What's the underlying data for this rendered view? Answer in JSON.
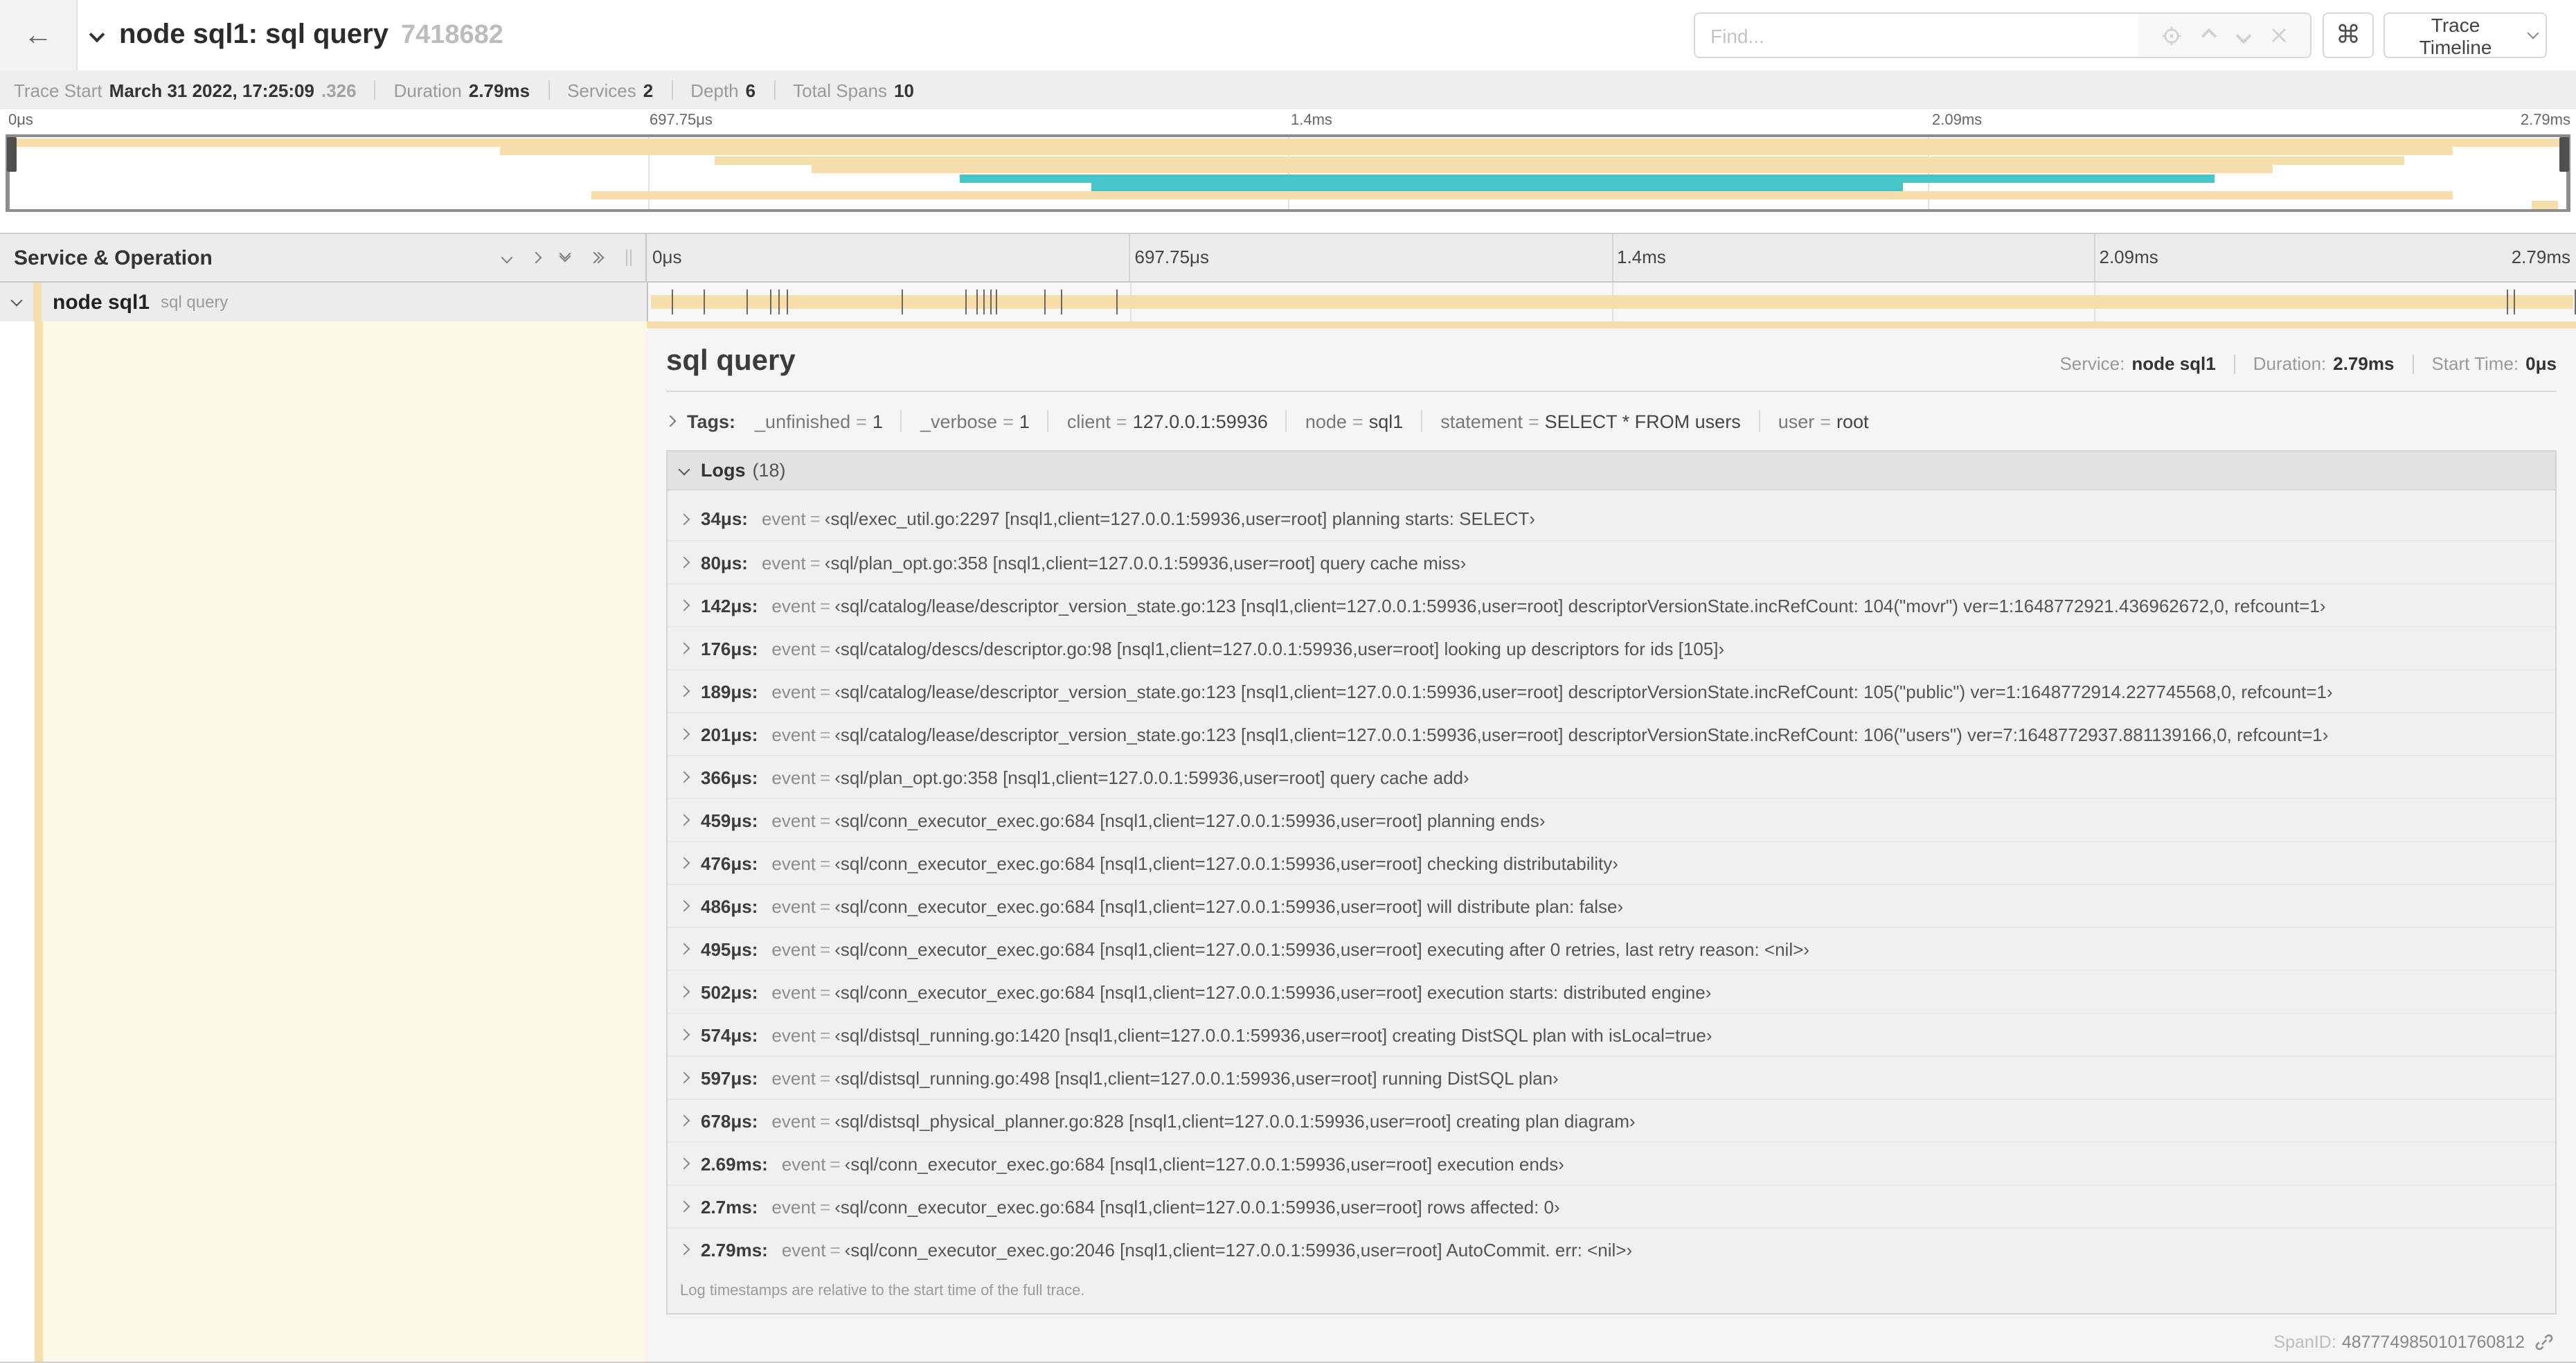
{
  "colors": {
    "tan": "#f6dfab",
    "teal": "#47c5c6",
    "cream": "#fdf7e8",
    "selected_row_bg": "#ececec"
  },
  "header": {
    "back_icon": "←",
    "title": "node sql1: sql query",
    "trace_id": "7418682",
    "find_placeholder": "Find...",
    "shortcut_key": "⌘",
    "view_selector": "Trace Timeline"
  },
  "trace_stats": [
    {
      "label": "Trace Start",
      "value": "March 31 2022, 17:25:09",
      "suffix": ".326"
    },
    {
      "label": "Duration",
      "value": "2.79ms"
    },
    {
      "label": "Services",
      "value": "2"
    },
    {
      "label": "Depth",
      "value": "6"
    },
    {
      "label": "Total Spans",
      "value": "10"
    }
  ],
  "minimap": {
    "ticks": [
      {
        "label": "0μs",
        "pos": 0
      },
      {
        "label": "697.75μs",
        "pos": 25
      },
      {
        "label": "1.4ms",
        "pos": 50
      },
      {
        "label": "2.09ms",
        "pos": 75
      },
      {
        "label": "2.79ms",
        "pos": 100
      }
    ],
    "spans": [
      {
        "start": 0,
        "end": 100,
        "color": "tan"
      },
      {
        "start": 19.2,
        "end": 95.5,
        "color": "tan"
      },
      {
        "start": 27.6,
        "end": 93.6,
        "color": "tan"
      },
      {
        "start": 31.4,
        "end": 88.5,
        "color": "tan"
      },
      {
        "start": 37.2,
        "end": 86.2,
        "color": "teal"
      },
      {
        "start": 42.3,
        "end": 74.0,
        "color": "teal"
      },
      {
        "start": 22.8,
        "end": 95.5,
        "color": "tan"
      },
      {
        "start": 98.6,
        "end": 99.6,
        "color": "tan"
      }
    ]
  },
  "timeline": {
    "left_header": "Service & Operation",
    "ticks": [
      {
        "label": "0μs",
        "pos": 0
      },
      {
        "label": "697.75μs",
        "pos": 25
      },
      {
        "label": "1.4ms",
        "pos": 50
      },
      {
        "label": "2.09ms",
        "pos": 75
      },
      {
        "label": "2.79ms",
        "pos": 100
      }
    ],
    "gridline_positions": [
      25,
      50,
      75
    ],
    "row": {
      "service": "node sql1",
      "operation": "sql query"
    },
    "log_tick_percents": [
      1.22,
      2.87,
      5.09,
      6.31,
      6.77,
      7.2,
      13.12,
      16.45,
      17.06,
      17.42,
      17.74,
      18.0,
      20.57,
      21.4,
      24.3,
      96.42,
      96.77,
      99.9
    ]
  },
  "detail": {
    "title": "sql query",
    "meta": [
      {
        "label": "Service:",
        "value": "node sql1"
      },
      {
        "label": "Duration:",
        "value": "2.79ms"
      },
      {
        "label": "Start Time:",
        "value": "0μs"
      }
    ],
    "tags_label": "Tags:",
    "tags": [
      {
        "key": "_unfinished",
        "value": "1"
      },
      {
        "key": "_verbose",
        "value": "1"
      },
      {
        "key": "client",
        "value": "127.0.0.1:59936"
      },
      {
        "key": "node",
        "value": "sql1"
      },
      {
        "key": "statement",
        "value": "SELECT * FROM users"
      },
      {
        "key": "user",
        "value": "root"
      }
    ],
    "logs_label": "Logs",
    "logs_count": "(18)",
    "logs": [
      {
        "time": "34μs:",
        "key": "event",
        "value": "‹sql/exec_util.go:2297 [nsql1,client=127.0.0.1:59936,user=root] planning starts: SELECT›"
      },
      {
        "time": "80μs:",
        "key": "event",
        "value": "‹sql/plan_opt.go:358 [nsql1,client=127.0.0.1:59936,user=root] query cache miss›"
      },
      {
        "time": "142μs:",
        "key": "event",
        "value": "‹sql/catalog/lease/descriptor_version_state.go:123 [nsql1,client=127.0.0.1:59936,user=root] descriptorVersionState.incRefCount: 104(\"movr\") ver=1:1648772921.436962672,0, refcount=1›"
      },
      {
        "time": "176μs:",
        "key": "event",
        "value": "‹sql/catalog/descs/descriptor.go:98 [nsql1,client=127.0.0.1:59936,user=root] looking up descriptors for ids [105]›"
      },
      {
        "time": "189μs:",
        "key": "event",
        "value": "‹sql/catalog/lease/descriptor_version_state.go:123 [nsql1,client=127.0.0.1:59936,user=root] descriptorVersionState.incRefCount: 105(\"public\") ver=1:1648772914.227745568,0, refcount=1›"
      },
      {
        "time": "201μs:",
        "key": "event",
        "value": "‹sql/catalog/lease/descriptor_version_state.go:123 [nsql1,client=127.0.0.1:59936,user=root] descriptorVersionState.incRefCount: 106(\"users\") ver=7:1648772937.881139166,0, refcount=1›"
      },
      {
        "time": "366μs:",
        "key": "event",
        "value": "‹sql/plan_opt.go:358 [nsql1,client=127.0.0.1:59936,user=root] query cache add›"
      },
      {
        "time": "459μs:",
        "key": "event",
        "value": "‹sql/conn_executor_exec.go:684 [nsql1,client=127.0.0.1:59936,user=root] planning ends›"
      },
      {
        "time": "476μs:",
        "key": "event",
        "value": "‹sql/conn_executor_exec.go:684 [nsql1,client=127.0.0.1:59936,user=root] checking distributability›"
      },
      {
        "time": "486μs:",
        "key": "event",
        "value": "‹sql/conn_executor_exec.go:684 [nsql1,client=127.0.0.1:59936,user=root] will distribute plan: false›"
      },
      {
        "time": "495μs:",
        "key": "event",
        "value": "‹sql/conn_executor_exec.go:684 [nsql1,client=127.0.0.1:59936,user=root] executing after 0 retries, last retry reason: <nil>›"
      },
      {
        "time": "502μs:",
        "key": "event",
        "value": "‹sql/conn_executor_exec.go:684 [nsql1,client=127.0.0.1:59936,user=root] execution starts: distributed engine›"
      },
      {
        "time": "574μs:",
        "key": "event",
        "value": "‹sql/distsql_running.go:1420 [nsql1,client=127.0.0.1:59936,user=root] creating DistSQL plan with isLocal=true›"
      },
      {
        "time": "597μs:",
        "key": "event",
        "value": "‹sql/distsql_running.go:498 [nsql1,client=127.0.0.1:59936,user=root] running DistSQL plan›"
      },
      {
        "time": "678μs:",
        "key": "event",
        "value": "‹sql/distsql_physical_planner.go:828 [nsql1,client=127.0.0.1:59936,user=root] creating plan diagram›"
      },
      {
        "time": "2.69ms:",
        "key": "event",
        "value": "‹sql/conn_executor_exec.go:684 [nsql1,client=127.0.0.1:59936,user=root] execution ends›"
      },
      {
        "time": "2.7ms:",
        "key": "event",
        "value": "‹sql/conn_executor_exec.go:684 [nsql1,client=127.0.0.1:59936,user=root] rows affected: 0›"
      },
      {
        "time": "2.79ms:",
        "key": "event",
        "value": "‹sql/conn_executor_exec.go:2046 [nsql1,client=127.0.0.1:59936,user=root] AutoCommit. err: <nil>›"
      }
    ],
    "logs_note": "Log timestamps are relative to the start time of the full trace.",
    "span_id_label": "SpanID:",
    "span_id": "4877749850101760812"
  }
}
